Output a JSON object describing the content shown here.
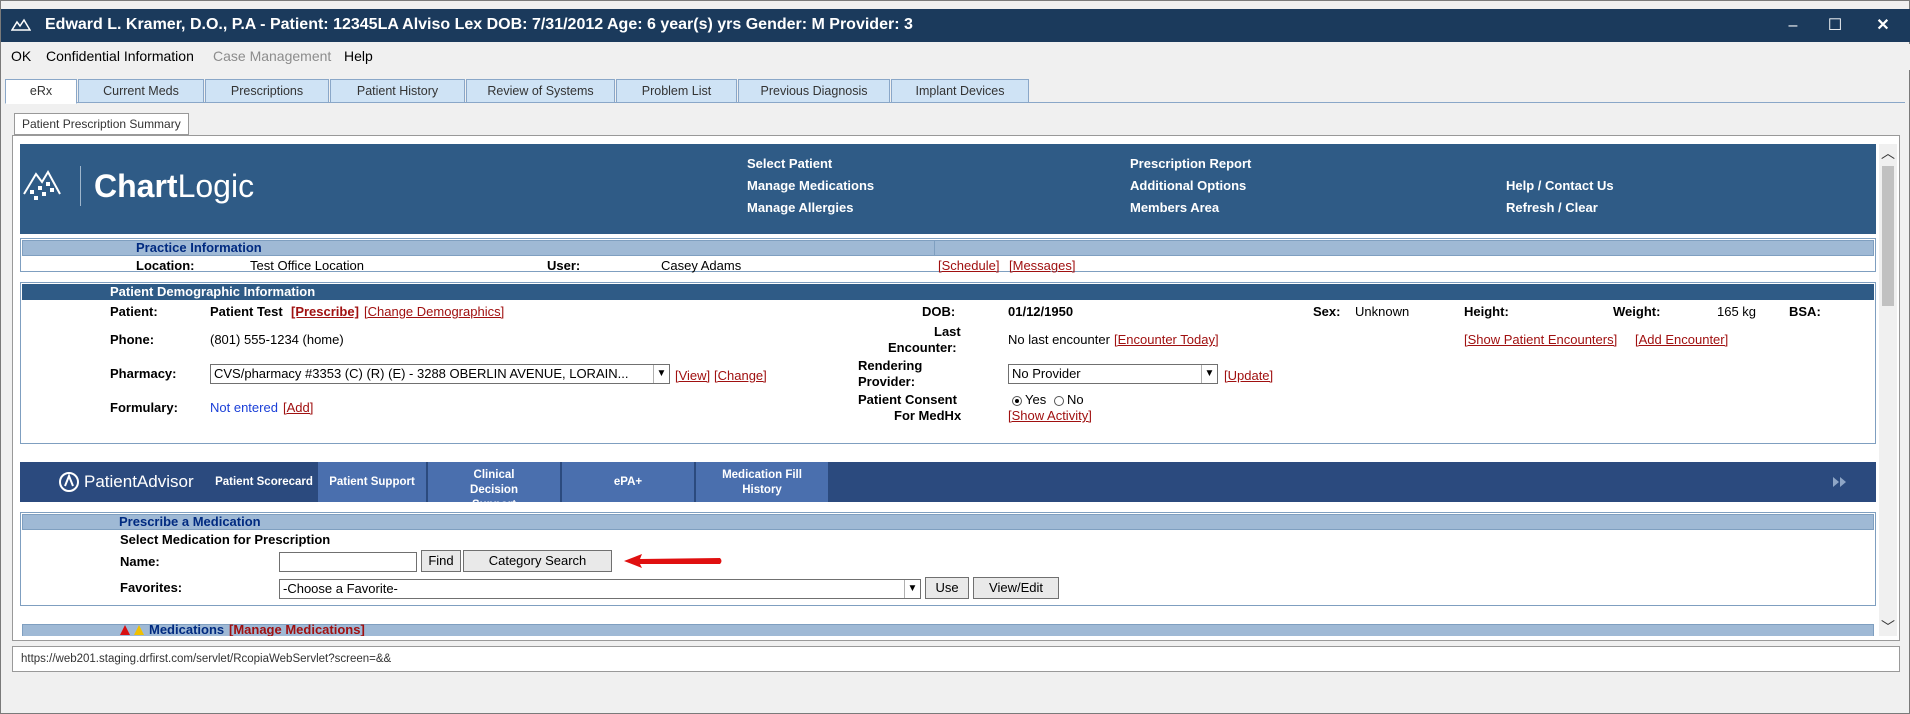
{
  "titlebar": {
    "title": "Edward L. Kramer, D.O., P.A - Patient: 12345LA Alviso  Lex DOB: 7/31/2012 Age: 6 year(s) yrs Gender: M Provider: 3",
    "minimize": "–",
    "maximize": "☐",
    "close": "✕"
  },
  "menu": [
    {
      "label": "OK"
    },
    {
      "label": "Confidential Information"
    },
    {
      "label": "Case Management"
    },
    {
      "label": "Help"
    }
  ],
  "tabs": [
    {
      "label": "eRx"
    },
    {
      "label": "Current Meds"
    },
    {
      "label": "Prescriptions"
    },
    {
      "label": "Patient History"
    },
    {
      "label": "Review of Systems"
    },
    {
      "label": "Problem List"
    },
    {
      "label": "Previous Diagnosis"
    },
    {
      "label": "Implant Devices"
    }
  ],
  "subtab": "Patient Prescription Summary",
  "banner": {
    "logo_a": "Chart",
    "logo_b": "Logic",
    "nav": {
      "select_patient": "Select Patient",
      "manage_medications": "Manage Medications",
      "manage_allergies": "Manage Allergies",
      "prescription_report": "Prescription Report",
      "additional_options": "Additional Options",
      "members_area": "Members Area",
      "help_contact": "Help / Contact Us",
      "refresh_clear": "Refresh / Clear"
    }
  },
  "practice": {
    "title": "Practice Information",
    "location_label": "Location:",
    "location_value": "Test Office Location",
    "user_label": "User:",
    "user_value": "Casey Adams",
    "schedule_link": "[Schedule]",
    "messages_link": "[Messages]"
  },
  "demographics": {
    "title": "Patient Demographic Information",
    "patient_label": "Patient:",
    "patient_value": "Patient Test",
    "prescribe_link": "[Prescribe]",
    "change_demo_link": "[Change Demographics]",
    "phone_label": "Phone:",
    "phone_value": "(801) 555-1234 (home)",
    "pharmacy_label": "Pharmacy:",
    "pharmacy_value": "CVS/pharmacy #3353 (C) (R) (E) - 3288 OBERLIN AVENUE, LORAIN...",
    "view_link": "[View]",
    "change_link": "[Change]",
    "formulary_label": "Formulary:",
    "formulary_value": "Not entered",
    "add_link": "[Add]",
    "dob_label": "DOB:",
    "dob_value": "01/12/1950",
    "last_enc_label_1": "Last",
    "last_enc_label_2": "Encounter:",
    "last_enc_value": "No last encounter",
    "encounter_today_link": "[Encounter Today]",
    "rendering_label_1": "Rendering",
    "rendering_label_2": "Provider:",
    "rendering_value": "No Provider",
    "update_link": "[Update]",
    "consent_label_1": "Patient Consent",
    "consent_label_2": "For MedHx",
    "consent_yes": "Yes",
    "consent_no": "No",
    "show_activity_link": "[Show Activity]",
    "sex_label": "Sex:",
    "sex_value": "Unknown",
    "height_label": "Height:",
    "weight_label": "Weight:",
    "weight_value": "165 kg",
    "bsa_label": "BSA:",
    "show_encounters_link": "[Show Patient Encounters]",
    "add_encounter_link": "[Add Encounter]"
  },
  "patientadvisor": {
    "logo": "PatientAdvisor",
    "tabs": [
      {
        "label": "Patient Scorecard"
      },
      {
        "label": "Patient Support"
      },
      {
        "label": "Clinical Decision Support"
      },
      {
        "label": "ePA+"
      },
      {
        "label": "Medication Fill History"
      }
    ]
  },
  "prescribe": {
    "title": "Prescribe a Medication",
    "subtitle": "Select Medication for Prescription",
    "name_label": "Name:",
    "find_button": "Find",
    "category_button": "Category Search",
    "favorites_label": "Favorites:",
    "favorites_value": "-Choose a Favorite-",
    "use_button": "Use",
    "viewedit_button": "View/Edit"
  },
  "medications": {
    "title": "Medications",
    "manage_link": "[Manage Medications]"
  },
  "status_url": "https://web201.staging.drfirst.com/servlet/RcopiaWebServlet?screen=&&",
  "colors": {
    "titlebar": "#1b3a5c",
    "banner": "#2f5b86",
    "section_bar": "#9fb9d5",
    "link": "#a01010",
    "arrow": "#e01010"
  }
}
